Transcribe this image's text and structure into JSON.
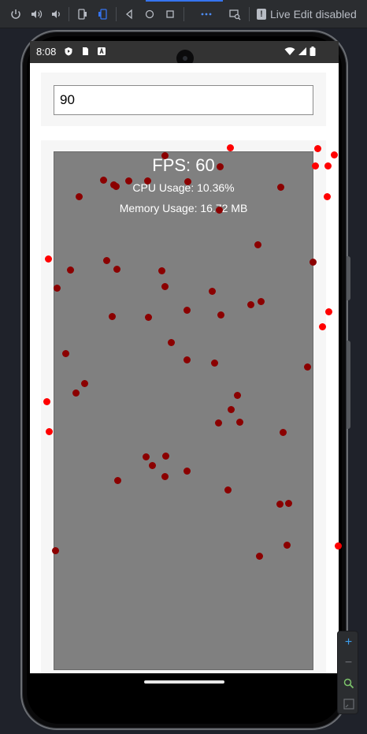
{
  "toolbar": {
    "icons": [
      "power-icon",
      "volume-up-icon",
      "volume-down-icon",
      "rotate-left-icon",
      "rotate-right-icon",
      "back-icon",
      "home-icon",
      "overview-icon",
      "more-icon",
      "screenshot-icon"
    ],
    "live_edit_label": "Live Edit disabled",
    "accent_color": "#3574f0"
  },
  "device": {
    "status_bar": {
      "time": "8:08"
    },
    "app": {
      "fps_input_value": "90",
      "fps_label": "FPS: 60",
      "cpu_label": "CPU Usage: 10.36%",
      "memory_label": "Memory Usage: 16.72 MB"
    }
  },
  "zoom_panel": {
    "zoom_in": "+",
    "zoom_out": "−"
  },
  "colors": {
    "canvas_bg": "#808080",
    "dot_inside": "#8b0000",
    "dot_outside": "#ff0000"
  }
}
